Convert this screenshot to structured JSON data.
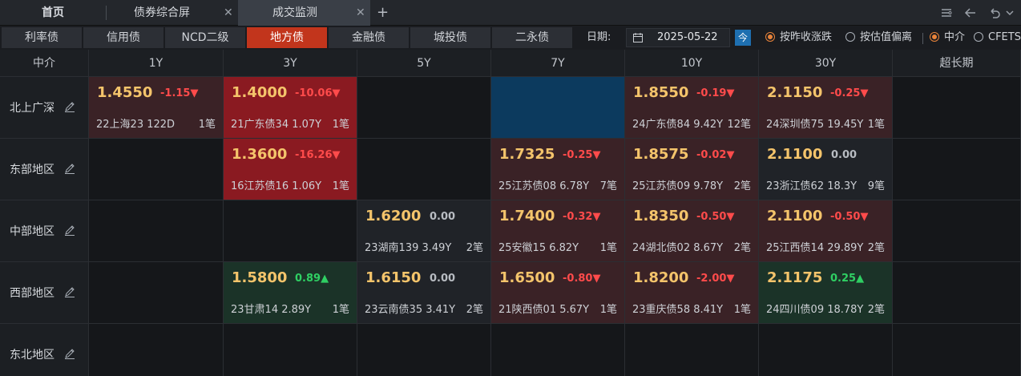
{
  "top_tabs": [
    {
      "label": "首页",
      "active": false
    },
    {
      "label": "债券综合屏",
      "active": false
    },
    {
      "label": "成交监测",
      "active": true
    }
  ],
  "sub_tabs": [
    "利率债",
    "信用债",
    "NCD二级",
    "地方债",
    "金融债",
    "城投债",
    "二永债"
  ],
  "active_sub_tab": "地方债",
  "date": {
    "label": "日期:",
    "value": "2025-05-22",
    "today_btn": "今"
  },
  "sort_options": [
    {
      "label": "按昨收涨跌",
      "selected": true
    },
    {
      "label": "按估值偏离",
      "selected": false
    }
  ],
  "source_options": [
    {
      "label": "中介",
      "selected": true
    },
    {
      "label": "CFETS",
      "selected": false
    }
  ],
  "table": {
    "corner": "中介",
    "columns": [
      "1Y",
      "3Y",
      "5Y",
      "7Y",
      "10Y",
      "30Y",
      "超长期"
    ],
    "rows": [
      {
        "region": "北上广深",
        "cells": [
          {
            "style": "red",
            "yield": "1.4550",
            "change": "-1.15▼",
            "dir": "down",
            "bond": "22上海23 122D",
            "count": "1笔"
          },
          {
            "style": "bright",
            "yield": "1.4000",
            "change": "-10.06▼",
            "dir": "down",
            "bond": "21广东债34 1.07Y",
            "count": "1笔"
          },
          null,
          {
            "style": "blue"
          },
          {
            "style": "red",
            "yield": "1.8550",
            "change": "-0.19▼",
            "dir": "down",
            "bond": "24广东债84 9.42Y",
            "count": "12笔"
          },
          {
            "style": "red",
            "yield": "2.1150",
            "change": "-0.25▼",
            "dir": "down",
            "bond": "24深圳债75 19.45Y",
            "count": "1笔"
          },
          null
        ]
      },
      {
        "region": "东部地区",
        "cells": [
          null,
          {
            "style": "bright",
            "yield": "1.3600",
            "change": "-16.26▼",
            "dir": "down",
            "bond": "16江苏债16 1.06Y",
            "count": "1笔"
          },
          null,
          {
            "style": "red",
            "yield": "1.7325",
            "change": "-0.25▼",
            "dir": "down",
            "bond": "25江苏债08 6.78Y",
            "count": "7笔"
          },
          {
            "style": "red",
            "yield": "1.8575",
            "change": "-0.02▼",
            "dir": "down",
            "bond": "25江苏债09 9.78Y",
            "count": "2笔"
          },
          {
            "style": "gray",
            "yield": "2.1100",
            "change": "0.00",
            "dir": "flat",
            "bond": "23浙江债62 18.3Y",
            "count": "9笔"
          },
          null
        ]
      },
      {
        "region": "中部地区",
        "cells": [
          null,
          null,
          {
            "style": "gray",
            "yield": "1.6200",
            "change": "0.00",
            "dir": "flat",
            "bond": "23湖南139 3.49Y",
            "count": "2笔"
          },
          {
            "style": "red",
            "yield": "1.7400",
            "change": "-0.32▼",
            "dir": "down",
            "bond": "25安徽15 6.82Y",
            "count": "1笔"
          },
          {
            "style": "red",
            "yield": "1.8350",
            "change": "-0.50▼",
            "dir": "down",
            "bond": "24湖北债02 8.67Y",
            "count": "2笔"
          },
          {
            "style": "red",
            "yield": "2.1100",
            "change": "-0.50▼",
            "dir": "down",
            "bond": "25江西债14 29.89Y",
            "count": "2笔"
          },
          null
        ]
      },
      {
        "region": "西部地区",
        "cells": [
          null,
          {
            "style": "green",
            "yield": "1.5800",
            "change": "0.89▲",
            "dir": "up",
            "bond": "23甘肃14 2.89Y",
            "count": "1笔"
          },
          {
            "style": "gray",
            "yield": "1.6150",
            "change": "0.00",
            "dir": "flat",
            "bond": "23云南债35 3.41Y",
            "count": "2笔"
          },
          {
            "style": "red",
            "yield": "1.6500",
            "change": "-0.80▼",
            "dir": "down",
            "bond": "21陕西债01 5.67Y",
            "count": "1笔"
          },
          {
            "style": "red",
            "yield": "1.8200",
            "change": "-2.00▼",
            "dir": "down",
            "bond": "23重庆债58 8.41Y",
            "count": "1笔"
          },
          {
            "style": "green",
            "yield": "2.1175",
            "change": "0.25▲",
            "dir": "up",
            "bond": "24四川债09 18.78Y",
            "count": "2笔"
          },
          null
        ]
      },
      {
        "region": "东北地区",
        "cells": [
          null,
          null,
          null,
          null,
          null,
          null,
          null
        ]
      }
    ]
  },
  "colors": {
    "accent": "#c2351c",
    "up": "#2fcf63",
    "down": "#ff4b4b",
    "yield": "#f4c46b"
  }
}
